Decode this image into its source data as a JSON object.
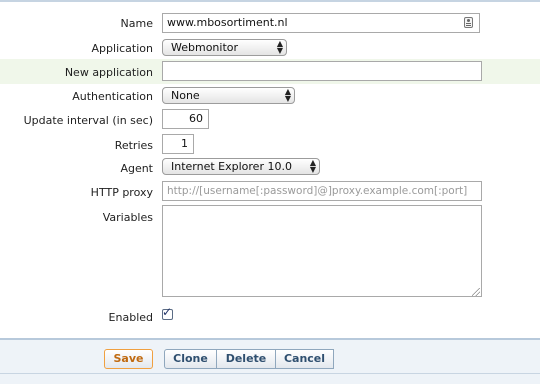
{
  "form": {
    "name": {
      "label": "Name",
      "value": "www.mbosortiment.nl",
      "icon": "contact-card-icon"
    },
    "application": {
      "label": "Application",
      "value": "Webmonitor"
    },
    "new_application": {
      "label": "New application",
      "value": ""
    },
    "authentication": {
      "label": "Authentication",
      "value": "None"
    },
    "update_interval": {
      "label": "Update interval (in sec)",
      "value": "60"
    },
    "retries": {
      "label": "Retries",
      "value": "1"
    },
    "agent": {
      "label": "Agent",
      "value": "Internet Explorer 10.0"
    },
    "http_proxy": {
      "label": "HTTP proxy",
      "placeholder": "http://[username[:password]@]proxy.example.com[:port]"
    },
    "variables": {
      "label": "Variables",
      "value": ""
    },
    "enabled": {
      "label": "Enabled",
      "checked": true
    }
  },
  "buttons": {
    "save": "Save",
    "clone": "Clone",
    "delete": "Delete",
    "cancel": "Cancel"
  },
  "colors": {
    "accent": "#3a6ea5",
    "highlight_row": "#f0f7ea",
    "footer": "#eef3f8"
  }
}
